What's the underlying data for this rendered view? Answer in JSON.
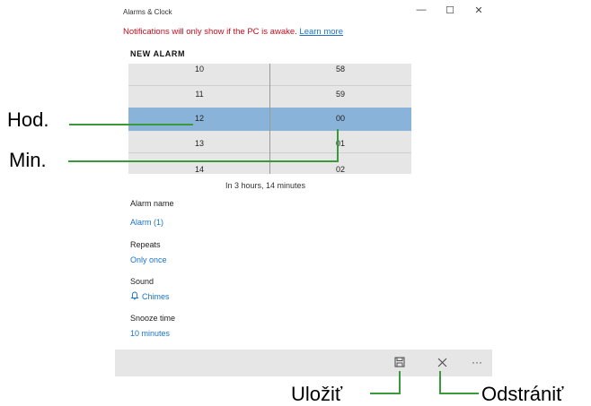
{
  "window": {
    "title": "Alarms & Clock",
    "minimize_glyph": "—",
    "maximize_glyph": "☐",
    "close_glyph": "✕"
  },
  "notice": {
    "text": "Notifications will only show if the PC is awake.",
    "link": "Learn more"
  },
  "section_header": "NEW ALARM",
  "picker": {
    "hours": [
      "10",
      "11",
      "12",
      "13",
      "14"
    ],
    "minutes": [
      "58",
      "59",
      "00",
      "01",
      "02"
    ],
    "selected_hour": "12",
    "selected_minute": "00"
  },
  "countdown": "In 3 hours, 14 minutes",
  "fields": {
    "alarm_name_label": "Alarm name",
    "alarm_name_value": "Alarm (1)",
    "repeats_label": "Repeats",
    "repeats_value": "Only once",
    "sound_label": "Sound",
    "sound_value": "Chimes",
    "snooze_label": "Snooze time",
    "snooze_value": "10 minutes"
  },
  "toolbar": {
    "save_icon": "save-icon",
    "delete_icon": "close-icon",
    "more_glyph": "···"
  },
  "callouts": {
    "hour": "Hod.",
    "minute": "Min.",
    "save": "Uložiť",
    "delete": "Odstrániť"
  },
  "colors": {
    "selection": "#8ab3d9",
    "notice_red": "#c50f1f",
    "link_blue": "#1a73c8",
    "callout_green": "#3a9a3a"
  }
}
